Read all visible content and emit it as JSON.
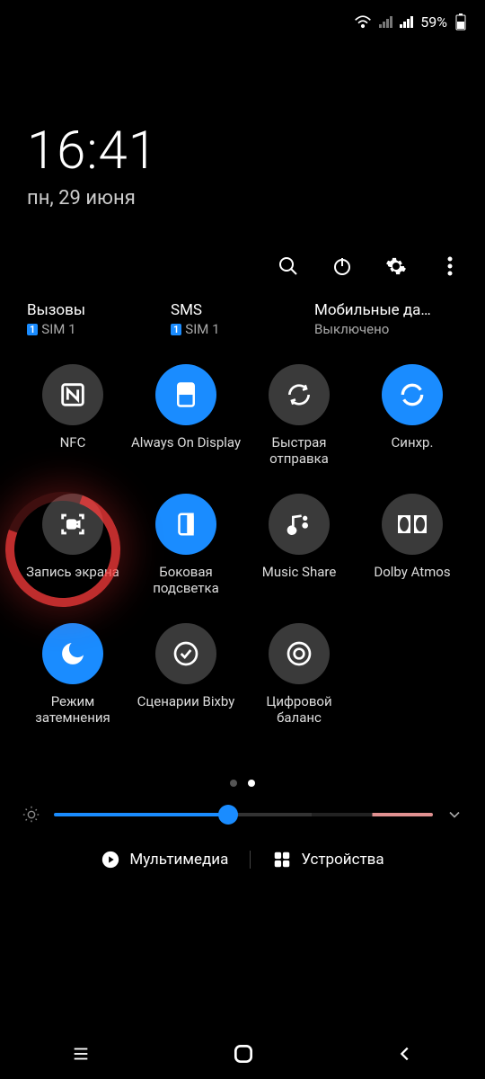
{
  "status": {
    "battery": "59%"
  },
  "clock": {
    "time": "16:41",
    "date": "пн, 29 июня"
  },
  "sims": [
    {
      "title": "Вызовы",
      "sub": "SIM 1",
      "badge": "1"
    },
    {
      "title": "SMS",
      "sub": "SIM 1",
      "badge": "1"
    },
    {
      "title": "Мобильные да…",
      "sub": "Выключено",
      "badge": ""
    }
  ],
  "tiles": [
    {
      "label": "NFC",
      "on": false,
      "icon": "nfc"
    },
    {
      "label": "Always On Display",
      "on": true,
      "icon": "aod"
    },
    {
      "label": "Быстрая отправка",
      "on": false,
      "icon": "quickshare"
    },
    {
      "label": "Синхр.",
      "on": true,
      "icon": "sync"
    },
    {
      "label": "Запись экрана",
      "on": false,
      "icon": "screenrec"
    },
    {
      "label": "Боковая подсветка",
      "on": true,
      "icon": "edge"
    },
    {
      "label": "Music Share",
      "on": false,
      "icon": "musicshare"
    },
    {
      "label": "Dolby Atmos",
      "on": false,
      "icon": "dolby"
    },
    {
      "label": "Режим затемнения",
      "on": true,
      "icon": "darkmode"
    },
    {
      "label": "Сценарии Bixby",
      "on": false,
      "icon": "bixby"
    },
    {
      "label": "Цифровой баланс",
      "on": false,
      "icon": "wellbeing"
    }
  ],
  "pager": {
    "count": 2,
    "active": 1
  },
  "brightness": {
    "value": 46
  },
  "bottom": {
    "media": "Мультимедиа",
    "devices": "Устройства"
  }
}
